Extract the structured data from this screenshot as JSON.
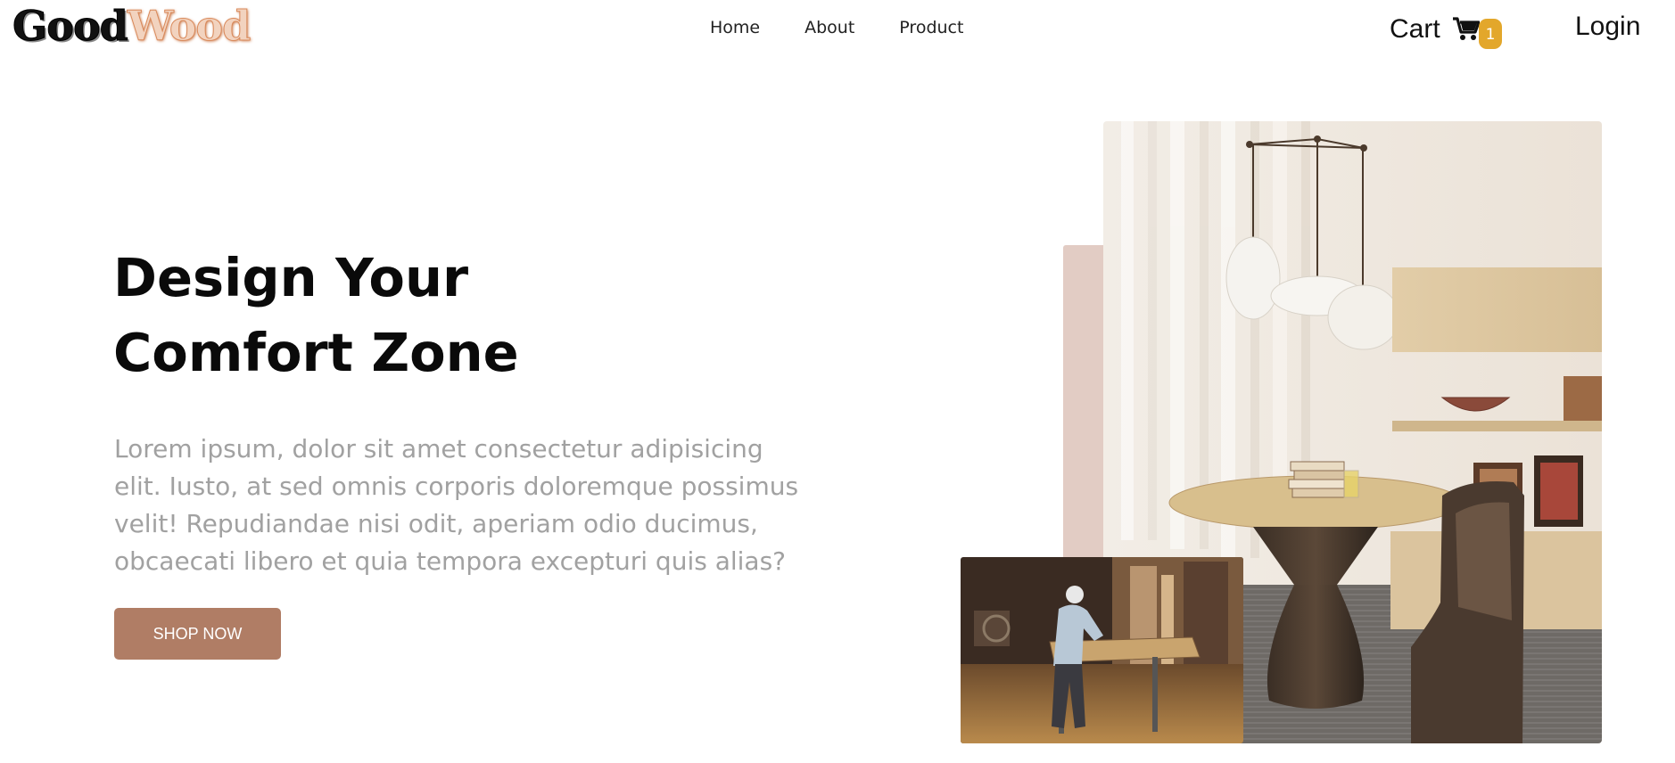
{
  "header": {
    "logo": {
      "part1": "Good",
      "part2": "Wood"
    },
    "nav": [
      {
        "label": "Home"
      },
      {
        "label": "About"
      },
      {
        "label": "Product"
      }
    ],
    "cart": {
      "label": "Cart",
      "icon": "cart-icon",
      "count": "1"
    },
    "login_label": "Login"
  },
  "hero": {
    "title": "Design Your Comfort Zone",
    "description": "Lorem ipsum, dolor sit amet consectetur adipisicing elit. Iusto, at sed omnis corporis doloremque possimus velit! Repudiandae nisi odit, aperiam odio ducimus, obcaecati libero et quia tempora excepturi quis alias?",
    "cta_label": "SHOP NOW"
  },
  "colors": {
    "cta": "#b07d65",
    "badge": "#e3a72b",
    "accent_block": "#e2ccc4",
    "description_text": "#a1a1a1"
  }
}
